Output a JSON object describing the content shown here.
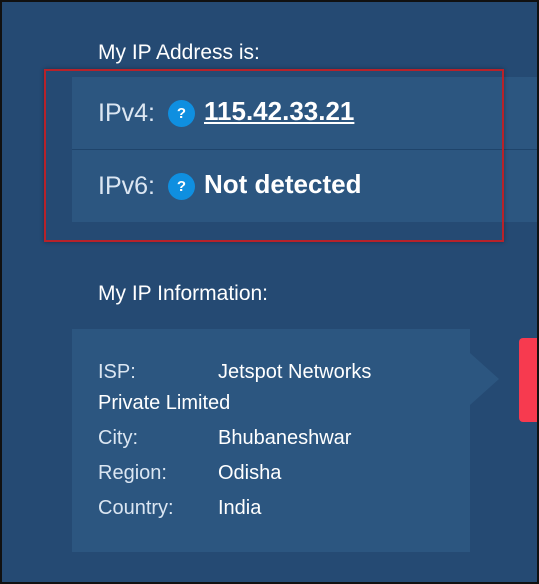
{
  "ip_address": {
    "title": "My IP Address is:",
    "ipv4_label": "IPv4:",
    "ipv4_value": "115.42.33.21",
    "ipv6_label": "IPv6:",
    "ipv6_value": "Not detected",
    "help_icon": "?"
  },
  "ip_information": {
    "title": "My IP Information:",
    "isp_label": "ISP:",
    "isp_value_line1": "Jetspot Networks",
    "isp_value_line2": "Private Limited",
    "city_label": "City:",
    "city_value": "Bhubaneshwar",
    "region_label": "Region:",
    "region_value": "Odisha",
    "country_label": "Country:",
    "country_value": "India"
  },
  "colors": {
    "background": "#254a73",
    "panel": "#2c5680",
    "highlight_border": "#b7222a",
    "help_icon": "#0f8fe0",
    "side_tab": "#f73a4f"
  },
  "icons": {
    "help": "question-circle-icon"
  }
}
